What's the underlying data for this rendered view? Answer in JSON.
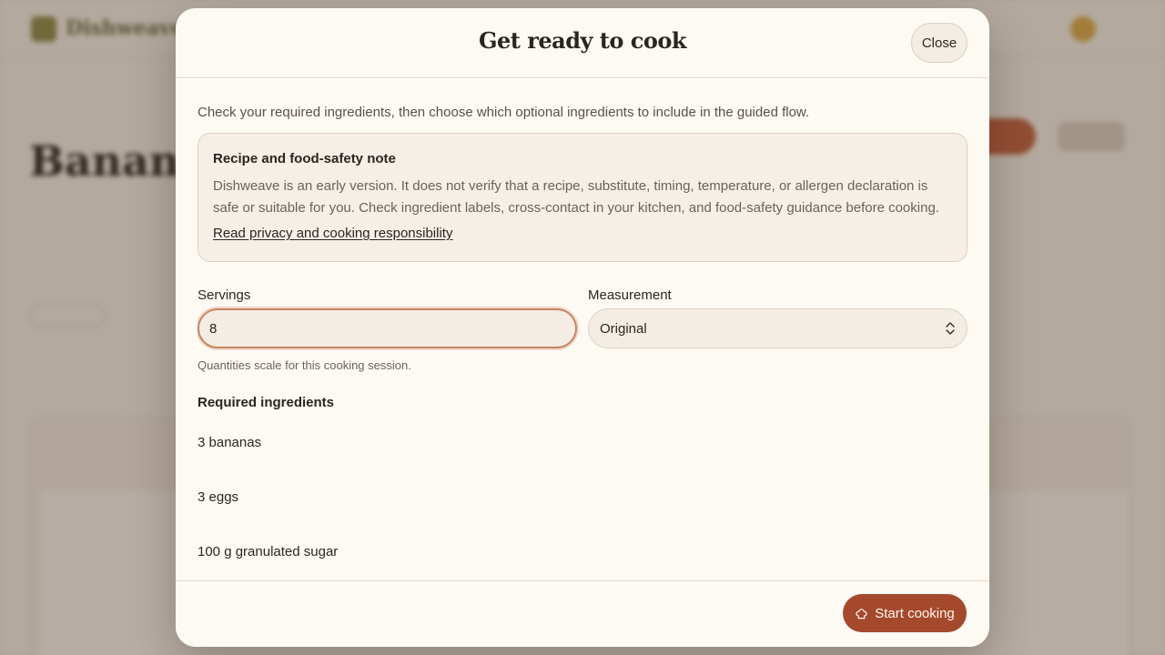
{
  "background": {
    "logo_text": "Dishweave",
    "eyebrow": "",
    "recipe_title": "Banana",
    "subtitle": "",
    "meta": ""
  },
  "modal": {
    "title": "Get ready to cook",
    "close_label": "Close",
    "intro": "Check your required ingredients, then choose which optional ingredients to include in the guided flow.",
    "note": {
      "title": "Recipe and food-safety note",
      "body": "Dishweave is an early version. It does not verify that a recipe, substitute, timing, temperature, or allergen declaration is safe or suitable for you. Check ingredient labels, cross-contact in your kitchen, and food-safety guidance before cooking.",
      "link": "Read privacy and cooking responsibility"
    },
    "servings": {
      "label": "Servings",
      "value": "8"
    },
    "measurement": {
      "label": "Measurement",
      "selected": "Original"
    },
    "hint": "Quantities scale for this cooking session.",
    "required_heading": "Required ingredients",
    "required_ingredients": [
      "3 bananas",
      "3 eggs",
      "100 g granulated sugar"
    ],
    "start_label": "Start cooking"
  },
  "colors": {
    "accent": "#a4492c",
    "modal_bg": "#fdfaf4",
    "note_bg": "#f5efe7"
  },
  "icons": {
    "close": "none",
    "select": "chevron-up-down-icon",
    "start": "chef-hat-icon"
  }
}
